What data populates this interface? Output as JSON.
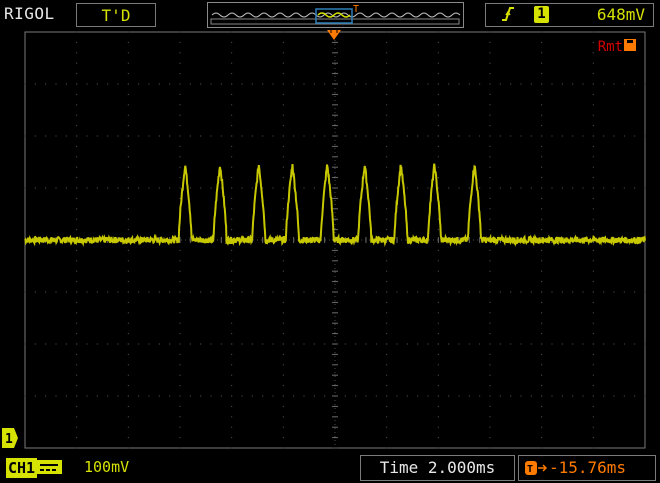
{
  "header": {
    "brand": "RIGOL",
    "run_status": "T'D",
    "trigger": {
      "slope_icon": "rising-edge-icon",
      "source": "1",
      "level": "648mV"
    }
  },
  "screen": {
    "remote_indicator": "Rmt",
    "trigger_position_marker": "T",
    "channel_ground_marker": "1"
  },
  "footer": {
    "channel_label": "CH1",
    "coupling_icon": "dc-coupling-icon",
    "vertical_scale": "100mV",
    "timebase": "Time 2.000ms",
    "trigger_offset": "-15.76ms"
  },
  "colors": {
    "trace": "#c8c800",
    "grid": "#5a5a5a",
    "text": "#e8e8e8",
    "trigger_marker": "#ff7a00",
    "remote": "#d40000"
  },
  "chart_data": {
    "type": "line",
    "title": "",
    "xlabel": "",
    "ylabel": "",
    "x_unit": "ms",
    "y_unit": "mV",
    "time_per_div_ms": 2.0,
    "volts_per_div_mV": 100,
    "xlim": [
      -24,
      24
    ],
    "ylim": [
      -400,
      400
    ],
    "series": [
      {
        "values_description": "baseline near 0 mV with 9 positive pulses",
        "baseline_mV": 0,
        "pulse_peak_mV": 145,
        "pulse_centers_ms": [
          -11.6,
          -8.9,
          -5.9,
          -3.3,
          -0.6,
          2.3,
          5.1,
          7.7,
          10.8
        ],
        "pulse_width_ms": 1.0
      }
    ]
  }
}
